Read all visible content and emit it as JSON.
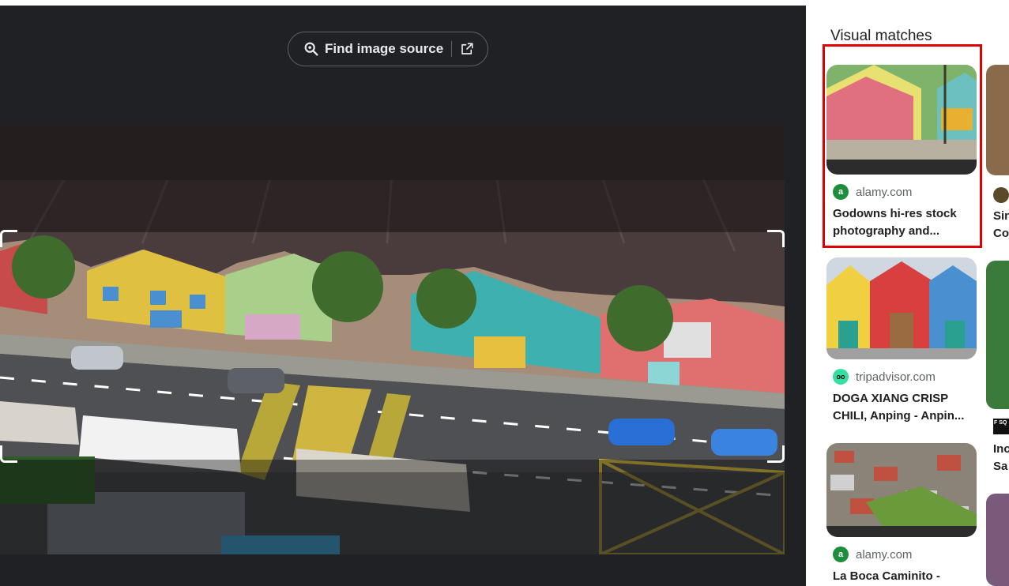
{
  "toolbar": {
    "find_source_label": "Find image source"
  },
  "visual_matches": {
    "title": "Visual matches",
    "cards": [
      {
        "site": "alamy.com",
        "favicon": "a",
        "title": "Godowns hi-res stock photography and..."
      },
      {
        "site": "tripadvisor.com",
        "favicon": "oo",
        "title": "DOGA XIANG CRISP CHILI, Anping - Anpin..."
      },
      {
        "site": "alamy.com",
        "favicon": "a",
        "title": "La Boca Caminito -"
      }
    ],
    "partial_column": {
      "card1_title_line1": "Sin",
      "card1_title_line2": "Co",
      "card2_badge": "F SQ",
      "card2_title_line1": "Inc",
      "card2_title_line2": "Sa"
    }
  },
  "colors": {
    "panel_bg": "#202124",
    "highlight": "#e00000",
    "alamy_fav": "#1e8e3e",
    "tripadvisor_fav": "#34e0a1"
  }
}
